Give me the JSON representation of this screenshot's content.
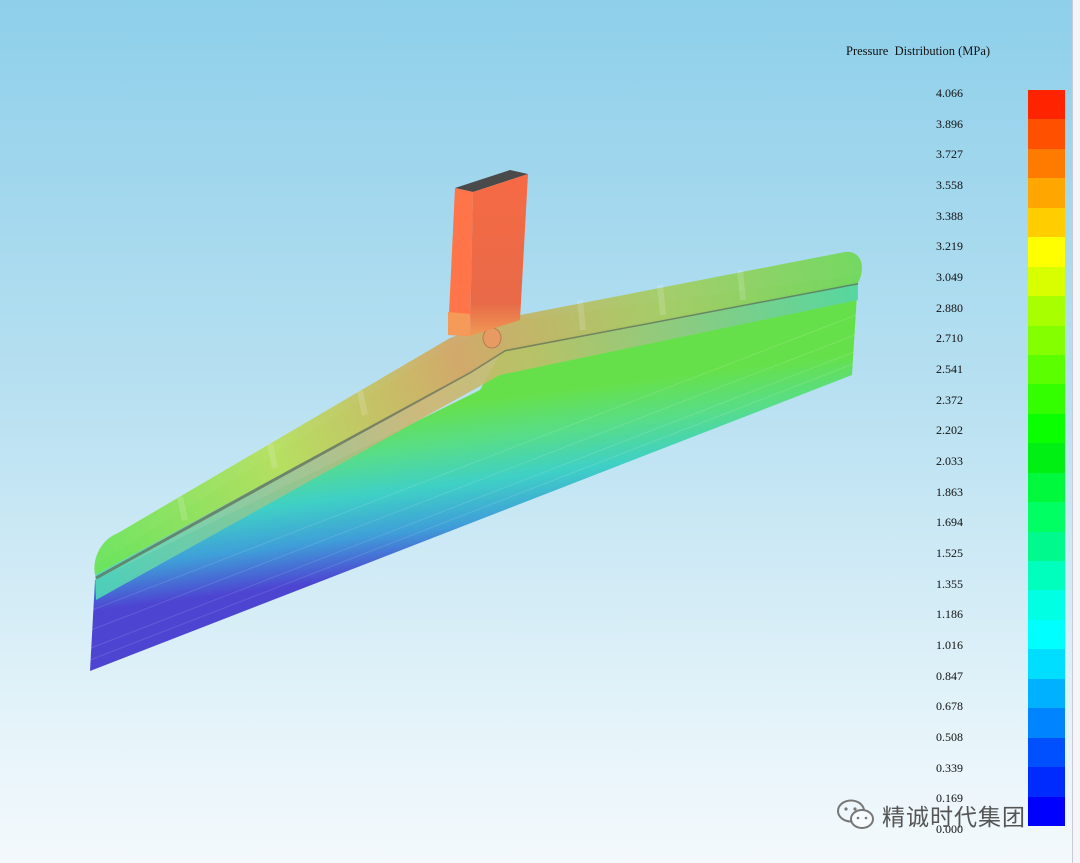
{
  "legend": {
    "title": "Pressure  Distribution (MPa)",
    "values": [
      "4.066",
      "3.896",
      "3.727",
      "3.558",
      "3.388",
      "3.219",
      "3.049",
      "2.880",
      "2.710",
      "2.541",
      "2.372",
      "2.202",
      "2.033",
      "1.863",
      "1.694",
      "1.525",
      "1.355",
      "1.186",
      "1.016",
      "0.847",
      "0.678",
      "0.508",
      "0.339",
      "0.169",
      "0.000"
    ],
    "colors": [
      "#ff2400",
      "#ff5000",
      "#ff7b00",
      "#ffa600",
      "#ffcd00",
      "#ffff00",
      "#d7ff00",
      "#a8ff00",
      "#84ff00",
      "#5cff00",
      "#34ff00",
      "#0aff00",
      "#00f014",
      "#00f93c",
      "#00ff62",
      "#00f98c",
      "#00ffbc",
      "#00ffe3",
      "#00ffff",
      "#00deff",
      "#00b1ff",
      "#0084ff",
      "#0050ff",
      "#002bff",
      "#0000ff"
    ]
  },
  "watermark": {
    "text": "精诚时代集团",
    "icon": "wechat-icon"
  }
}
